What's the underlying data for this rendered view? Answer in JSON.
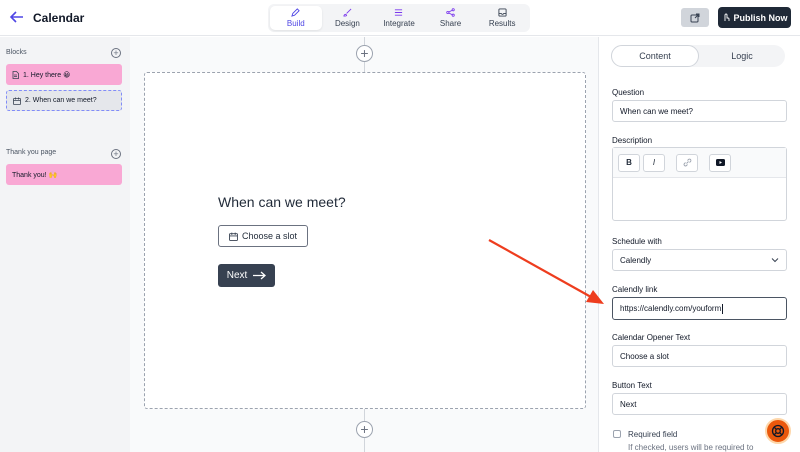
{
  "header": {
    "title": "Calendar",
    "tabs": [
      {
        "label": "Build",
        "icon": "pen-icon"
      },
      {
        "label": "Design",
        "icon": "brush-icon"
      },
      {
        "label": "Integrate",
        "icon": "sliders-icon"
      },
      {
        "label": "Share",
        "icon": "share-icon"
      },
      {
        "label": "Results",
        "icon": "inbox-icon"
      }
    ],
    "active_tab": "Build",
    "publish_label": "Publish Now"
  },
  "sidebar": {
    "blocks_label": "Blocks",
    "blocks": [
      {
        "label": "1. Hey there 😀",
        "icon": "document-icon"
      },
      {
        "label": "2. When can we meet?",
        "icon": "calendar-icon"
      }
    ],
    "thank_you_label": "Thank you page",
    "thank_you_blocks": [
      {
        "label": "Thank you! 🙌"
      }
    ]
  },
  "canvas": {
    "question": "When can we meet?",
    "slot_button": "Choose a slot",
    "next_button": "Next"
  },
  "panel": {
    "tabs": [
      "Content",
      "Logic"
    ],
    "active_tab": "Content",
    "question_label": "Question",
    "question_value": "When can we meet?",
    "description_label": "Description",
    "toolbar": [
      "B",
      "I",
      "link-icon",
      "youtube-icon"
    ],
    "schedule_label": "Schedule with",
    "schedule_value": "Calendly",
    "calendly_label": "Calendly link",
    "calendly_value": "https://calendly.com/youform",
    "opener_label": "Calendar Opener Text",
    "opener_value": "Choose a slot",
    "button_text_label": "Button Text",
    "button_text_value": "Next",
    "required_label": "Required field",
    "required_help": "If checked, users will be required to"
  },
  "colors": {
    "accent": "#4f46e5",
    "block_pink": "#f9a8d4",
    "annotation_arrow": "#ee3d1e",
    "publish_bg": "#1f2937",
    "help_fab": "#ea580c"
  }
}
